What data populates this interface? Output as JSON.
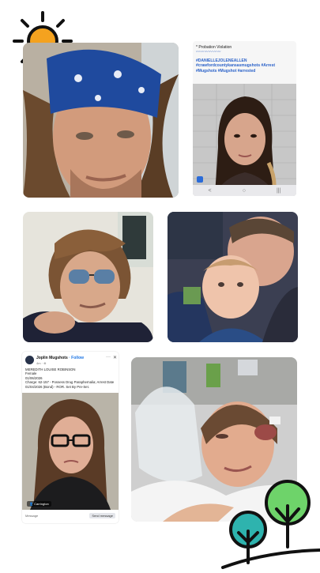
{
  "colors": {
    "sun": "#f4a21f",
    "sun_rays": "#111111",
    "tree_green": "#6ed36a",
    "tree_teal": "#2eb3ae",
    "tree_outline": "#111111",
    "hashtag_blue": "#2b62c9",
    "fb_blue": "#1b74e4"
  },
  "icons": {
    "sun": "sun-icon",
    "trees": "trees-logo-icon"
  },
  "post_card": {
    "caption_line1": "* Probation Violation",
    "separator": "〰〰〰〰〰〰",
    "hashtags": "#DANIELLEJOLENEALLEN #crawfordcountykansasmugshots #Arrest #Mugshots #Mugshot #arrested",
    "nav_icons": [
      "<",
      "○",
      "|||"
    ]
  },
  "fb_card": {
    "page_name": "Joplin Mugshots",
    "follow_label": "· Follow",
    "time": "4m · ⊕",
    "menu_label": "···",
    "close_label": "✕",
    "body_lines": [
      "MEREDITH LOUISE ROBINSON",
      "Female",
      "01/06/2026",
      "Charge: 62-157 - Possess Drug Paraphernalia; Arrest Date 01/04/2026 (Bond) - ROR. Set By Pre-Set."
    ],
    "image_tag": "👤 Carrington",
    "footer_left": "Message",
    "footer_right": "Send message"
  }
}
